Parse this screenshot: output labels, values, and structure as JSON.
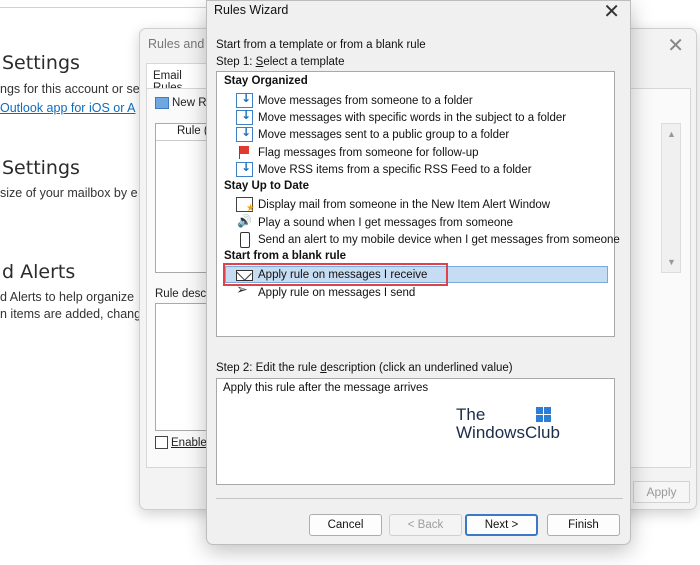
{
  "background": {
    "sections": [
      {
        "heading": "Settings",
        "lines": [
          "ngs for this account or set",
          "Outlook app for iOS or A"
        ]
      },
      {
        "heading": "Settings",
        "lines": [
          "size of your mailbox by e"
        ]
      },
      {
        "heading": "d Alerts",
        "lines": [
          "d Alerts to help organize",
          "n items are added, chang"
        ]
      }
    ]
  },
  "rules_dialog": {
    "title": "Rules and A",
    "tab": "Email Rules",
    "new_rule": "New R",
    "list_column": "Rule (",
    "desc_label": "Rule descr",
    "enable_label": "Enable",
    "apply": "Apply"
  },
  "wizard": {
    "title": "Rules Wizard",
    "caption": "Start from a template or from a blank rule",
    "step1_prefix": "Step 1: ",
    "step1_underlined": "S",
    "step1_rest": "elect a template",
    "groups": [
      {
        "heading": "Stay Organized",
        "items": [
          {
            "label": "Move messages from someone to a folder",
            "icon": "move-to-folder-icon"
          },
          {
            "label": "Move messages with specific words in the subject to a folder",
            "icon": "move-to-folder-icon"
          },
          {
            "label": "Move messages sent to a public group to a folder",
            "icon": "move-to-folder-icon"
          },
          {
            "label": "Flag messages from someone for follow-up",
            "icon": "flag-icon"
          },
          {
            "label": "Move RSS items from a specific RSS Feed to a folder",
            "icon": "move-to-folder-icon"
          }
        ]
      },
      {
        "heading": "Stay Up to Date",
        "items": [
          {
            "label": "Display mail from someone in the New Item Alert Window",
            "icon": "alert-window-icon"
          },
          {
            "label": "Play a sound when I get messages from someone",
            "icon": "speaker-icon"
          },
          {
            "label": "Send an alert to my mobile device when I get messages from someone",
            "icon": "mobile-device-icon"
          }
        ]
      },
      {
        "heading": "Start from a blank rule",
        "items": [
          {
            "label": "Apply rule on messages I receive",
            "icon": "envelope-icon",
            "selected": true
          },
          {
            "label": "Apply rule on messages I send",
            "icon": "send-icon"
          }
        ]
      }
    ],
    "step2_prefix": "Step 2: Edit the rule ",
    "step2_underlined": "d",
    "step2_rest": "escription (click an underlined value)",
    "description": "Apply this rule after the message arrives",
    "watermark_line1": "The",
    "watermark_line2": "WindowsClub",
    "buttons": {
      "cancel": "Cancel",
      "back": "< Back",
      "next": "Next >",
      "finish": "Finish"
    }
  }
}
